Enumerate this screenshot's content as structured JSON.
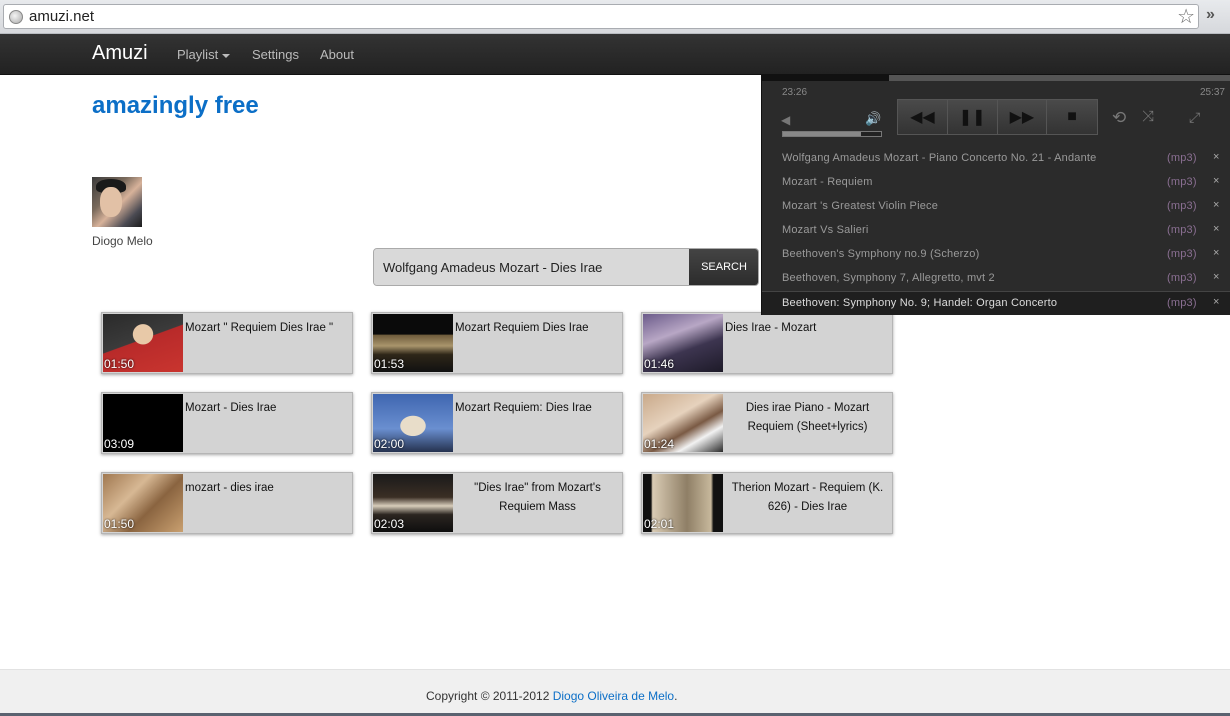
{
  "browser": {
    "url": "amuzi.net"
  },
  "navbar": {
    "brand": "Amuzi",
    "items": [
      {
        "label": "Playlist",
        "dropdown": true
      },
      {
        "label": "Settings"
      },
      {
        "label": "About"
      }
    ]
  },
  "tagline": "amazingly free",
  "user": {
    "name": "Diogo Melo"
  },
  "search": {
    "value": "Wolfgang Amadeus Mozart - Dies Irae",
    "button_label": "SEARCH"
  },
  "results": [
    {
      "title": "Mozart \" Requiem Dies Irae \"",
      "duration": "01:50",
      "thumb": "portrait-red"
    },
    {
      "title": "Mozart Requiem Dies Irae",
      "duration": "01:53",
      "thumb": "concert-hall"
    },
    {
      "title": "Dies Irae - Mozart",
      "duration": "01:46",
      "thumb": "church-choir"
    },
    {
      "title": "Mozart - Dies Irae",
      "duration": "03:09",
      "thumb": "black"
    },
    {
      "title": "Mozart Requiem: Dies Irae",
      "duration": "02:00",
      "thumb": "statue-sky"
    },
    {
      "title": "Dies irae Piano - Mozart Requiem (Sheet+lyrics)",
      "duration": "01:24",
      "thumb": "piano"
    },
    {
      "title": "mozart - dies irae",
      "duration": "01:50",
      "thumb": "painting"
    },
    {
      "title": "\"Dies Irae\" from Mozart's Requiem Mass",
      "duration": "02:03",
      "thumb": "choir-stage"
    },
    {
      "title": "Therion Mozart - Requiem (K. 626) - Dies Irae",
      "duration": "02:01",
      "thumb": "dark-art"
    }
  ],
  "player": {
    "current_time": "23:26",
    "total_time": "25:37",
    "progress": 0.27,
    "volume": 0.8,
    "playlist": [
      {
        "title": "Wolfgang Amadeus Mozart - Piano Concerto No. 21 - Andante",
        "format": "(mp3)",
        "active": false
      },
      {
        "title": "Mozart - Requiem",
        "format": "(mp3)",
        "active": false
      },
      {
        "title": "Mozart 's Greatest Violin Piece",
        "format": "(mp3)",
        "active": false
      },
      {
        "title": "Mozart Vs Salieri",
        "format": "(mp3)",
        "active": false
      },
      {
        "title": "Beethoven's Symphony no.9 (Scherzo)",
        "format": "(mp3)",
        "active": false
      },
      {
        "title": "Beethoven, Symphony 7, Allegretto, mvt 2",
        "format": "(mp3)",
        "active": false
      },
      {
        "title": "Beethoven: Symphony No. 9; Handel: Organ Concerto",
        "format": "(mp3)",
        "active": true
      }
    ],
    "remove_glyph": "×"
  },
  "footer": {
    "copyright": "Copyright © 2011-2012 ",
    "author_link": "Diogo Oliveira de Melo",
    "trailing": "."
  },
  "colors": {
    "accent": "#0c6fc7",
    "navbar_bg": "#222222",
    "player_bg": "#2b2b2b",
    "card_bg": "#d3d3d3"
  }
}
